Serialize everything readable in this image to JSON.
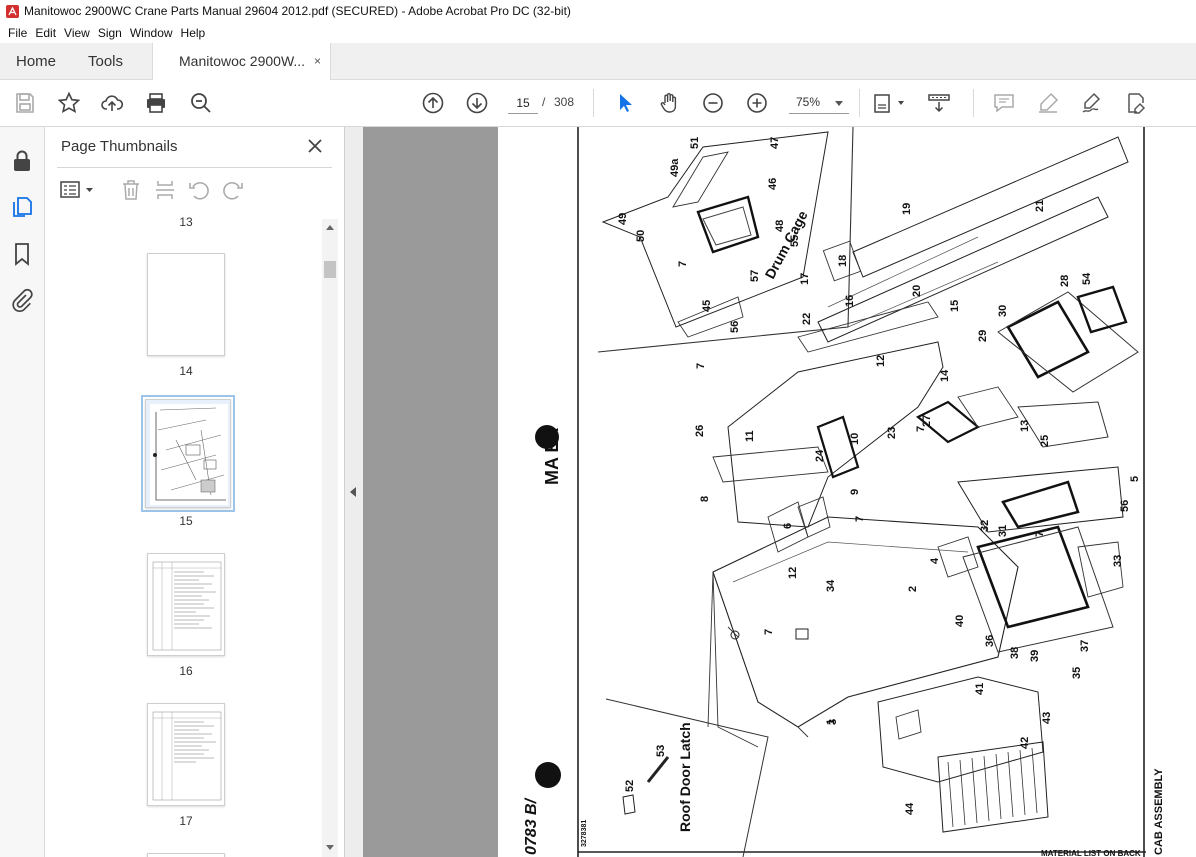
{
  "window": {
    "title": "Manitowoc 2900WC Crane Parts Manual 29604 2012.pdf (SECURED) - Adobe Acrobat Pro DC (32-bit)"
  },
  "menu": [
    "File",
    "Edit",
    "View",
    "Sign",
    "Window",
    "Help"
  ],
  "tabs": {
    "home": "Home",
    "tools": "Tools",
    "document": "Manitowoc 2900W...",
    "close_glyph": "×"
  },
  "toolbar": {
    "current_page": "15",
    "separator": "/",
    "total_pages": "308",
    "zoom": "75%"
  },
  "panel": {
    "title": "Page Thumbnails",
    "thumbnails": [
      {
        "label": "13"
      },
      {
        "label": "14"
      },
      {
        "label": "15",
        "selected": true
      },
      {
        "label": "16"
      },
      {
        "label": "17"
      }
    ]
  },
  "drawing": {
    "labels": {
      "drum_cage": "Drum Cage",
      "roof_door_latch": "Roof Door Latch",
      "brand": "MA  ER",
      "cab_assembly": "CAB ASSEMBLY",
      "material_list": "MATERIAL LIST ON BACK",
      "drawing_no": "0783 B/",
      "serial": "3278381"
    },
    "part_numbers": [
      "51",
      "49a",
      "47",
      "46",
      "49",
      "50",
      "48",
      "55",
      "7",
      "18",
      "17",
      "19",
      "21",
      "16",
      "20",
      "15",
      "22",
      "45",
      "57",
      "56",
      "54",
      "30",
      "29",
      "28",
      "7",
      "12",
      "14",
      "27",
      "26",
      "11",
      "10",
      "7",
      "23",
      "13",
      "25",
      "24",
      "8",
      "9",
      "7",
      "6",
      "5",
      "56",
      "31",
      "32",
      "7",
      "12",
      "4",
      "33",
      "34",
      "2",
      "40",
      "39",
      "38",
      "37",
      "35",
      "36",
      "7",
      "3",
      "41",
      "43",
      "42",
      "1",
      "44",
      "53",
      "52"
    ]
  },
  "colors": {
    "accent_blue": "#1473e6",
    "doc_background": "#9a9a9a",
    "selected_outline": "#9cc4e8"
  }
}
